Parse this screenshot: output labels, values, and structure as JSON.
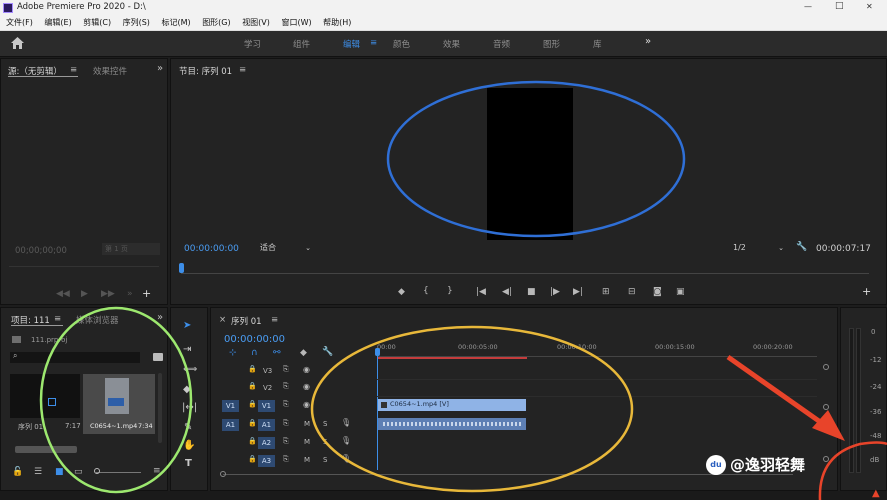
{
  "app": {
    "title": "Adobe Premiere Pro 2020 - D:\\"
  },
  "window_controls": {
    "minimize": "—",
    "maximize": "□",
    "close": "✕"
  },
  "menu": [
    "文件(F)",
    "编辑(E)",
    "剪辑(C)",
    "序列(S)",
    "标记(M)",
    "图形(G)",
    "视图(V)",
    "窗口(W)",
    "帮助(H)"
  ],
  "workspaces": {
    "tabs": [
      "学习",
      "组件",
      "编辑",
      "颜色",
      "效果",
      "音频",
      "图形",
      "库"
    ],
    "active": "编辑",
    "more": "»",
    "menu_glyph": "≡"
  },
  "source_panel": {
    "tab_source": "源:（无剪辑）",
    "tab_effects": "效果控件",
    "timecode": "00;00;00;00",
    "fit_label": "第 1 页",
    "overflow": "»",
    "menu_glyph": "≡",
    "add_glyph": "+"
  },
  "program_panel": {
    "title": "节目: 序列 01",
    "menu_glyph": "≡",
    "timecode": "00:00:00:00",
    "fit": "适合",
    "resolution": "1/2",
    "duration": "00:00:07:17",
    "add_glyph": "+"
  },
  "project_panel": {
    "tab_project": "项目: 111",
    "tab_media": "媒体浏览器",
    "menu_glyph": "≡",
    "overflow": "»",
    "file_name": "111.prproj",
    "search_placeholder": "",
    "items": [
      {
        "name": "序列 01",
        "duration": "7:17"
      },
      {
        "name": "C0654~1.mp4",
        "duration": "7:34"
      }
    ]
  },
  "timeline": {
    "title": "序列 01",
    "menu_glyph": "≡",
    "close_glyph": "×",
    "timecode": "00:00:00:00",
    "ruler": [
      "00:00",
      "00:00:05:00",
      "00:00:10:00",
      "00:00:15:00",
      "00:00:20:00"
    ],
    "video_tracks": [
      "V3",
      "V2",
      "V1"
    ],
    "audio_tracks": [
      "A1",
      "A2",
      "A3"
    ],
    "source_v": "V1",
    "source_a": "A1",
    "mute": "M",
    "solo": "S",
    "video_clip": "C0654~1.mp4 [V]"
  },
  "audio_meter": {
    "labels": [
      "0",
      "-12",
      "-24",
      "-36",
      "-48",
      "dB"
    ]
  },
  "watermark": {
    "text": "@逸羽轻舞",
    "logo": "du"
  },
  "colors": {
    "accent_blue": "#3d8ee8",
    "annotation_blue": "#2f6fd6",
    "annotation_green": "#9de86f",
    "annotation_yellow": "#e8b83a",
    "annotation_red": "#e8442a"
  }
}
